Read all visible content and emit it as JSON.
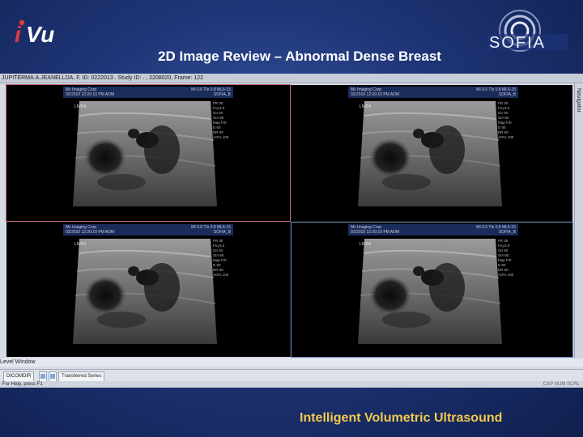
{
  "slide": {
    "title": "2D Image Review – Abnormal Dense Breast",
    "tagline": "Intelligent Volumetric Ultrasound",
    "logo_left": "iVu",
    "logo_right": "SOFIA"
  },
  "app": {
    "patient_bar": "JUPITERMA.A.JEANELLDA, F, ID: 0222013 . Study ID: . , 2208020, Frame: 122",
    "navigator_label": "Navigator",
    "level_window_label": "Level Window",
    "taskbar": {
      "dicomdir_label": "DICOMDIR",
      "transferred_label": "Transferred Series"
    },
    "status_left": "For Help, press F1",
    "status_right": "CAP  NUM  SCRL"
  },
  "panes": [
    {
      "header_left_1": "Mv Imaging Corp",
      "header_left_2": "02/2010 12:20:10 PM ADM",
      "header_right_1": "MI 0.6   TIs 0.8   ML6-15",
      "header_right_2": "SOFIA_B",
      "scan_label": "LN/BA"
    },
    {
      "header_left_1": "Mv Imaging Corp",
      "header_left_2": "02/2010 12:20:10 PM ADM",
      "header_right_1": "MI 0.6   TIs 0.8   ML6-15",
      "header_right_2": "SOFIA_B",
      "scan_label": "LN/BA"
    },
    {
      "header_left_1": "Mv Imaging Corp",
      "header_left_2": "02/2010 12:20:10 PM ADM",
      "header_right_1": "MI 0.6   TIs 0.8   ML6-15",
      "header_right_2": "SOFIA_B",
      "scan_label": "LN/BA"
    },
    {
      "header_left_1": "Mv Imaging Corp",
      "header_left_2": "02/2010 12:20:10 PM ADM",
      "header_right_1": "MI 0.6   TIs 0.8   ML6-15",
      "header_right_2": "SOFIA_B",
      "scan_label": "LN/BA"
    }
  ],
  "params": [
    "FR  30",
    "Frq  8.0",
    "Gn  50",
    "S/A  80",
    "Map  F/0",
    "D  60",
    "DR  60",
    "AO%  100"
  ]
}
